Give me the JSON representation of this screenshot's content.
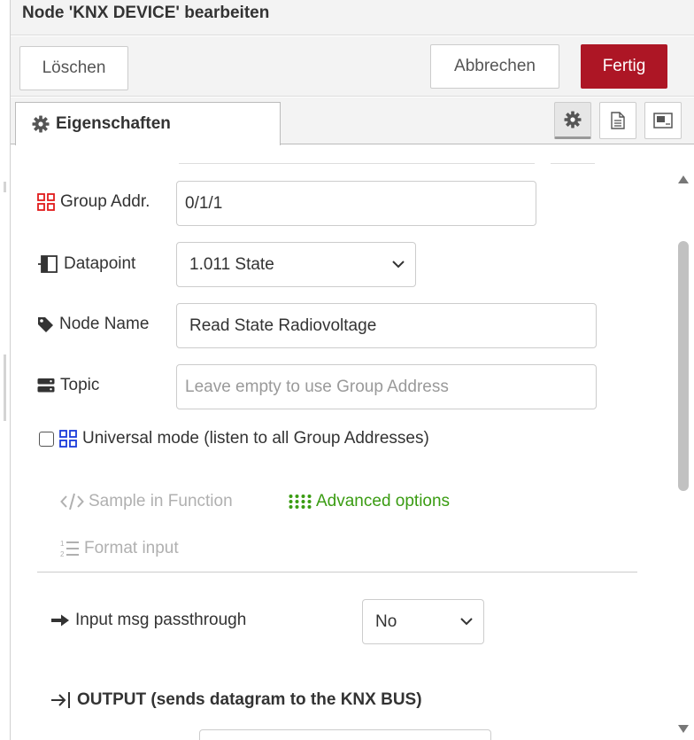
{
  "header": {
    "title": "Node 'KNX DEVICE' bearbeiten"
  },
  "toolbar": {
    "delete_label": "Löschen",
    "cancel_label": "Abbrechen",
    "done_label": "Fertig"
  },
  "colors": {
    "primary": "#ad1625",
    "advanced_link": "#3a9c12",
    "group_icon_red": "#e11b1b",
    "universal_icon_blue": "#1a3adb"
  },
  "tabs": [
    {
      "label": "Eigenschaften",
      "icon": "gear-icon"
    }
  ],
  "tab_buttons": [
    {
      "icon": "gear-icon",
      "active": true
    },
    {
      "icon": "document-icon",
      "active": false
    },
    {
      "icon": "layout-icon",
      "active": false
    }
  ],
  "form": {
    "group_addr": {
      "label": "Group Addr.",
      "value": "0/1/1",
      "icon": "group-address-icon"
    },
    "datapoint": {
      "label": "Datapoint",
      "value": "1.011 State",
      "icon": "datapoint-icon"
    },
    "node_name": {
      "label": "Node Name",
      "value": "Read State Radiovoltage",
      "icon": "tag-icon"
    },
    "topic": {
      "label": "Topic",
      "placeholder": "Leave empty to use Group Address",
      "icon": "server-icon"
    },
    "universal": {
      "label": "Universal mode (listen to all Group Addresses)",
      "checked": false,
      "icon": "grid-icon"
    }
  },
  "links": {
    "sample_function": "Sample in Function",
    "advanced_options": "Advanced options",
    "format_input": "Format input"
  },
  "passthrough": {
    "label": "Input msg passthrough",
    "value": "No"
  },
  "output_heading": "OUTPUT (sends datagram to the KNX BUS)"
}
